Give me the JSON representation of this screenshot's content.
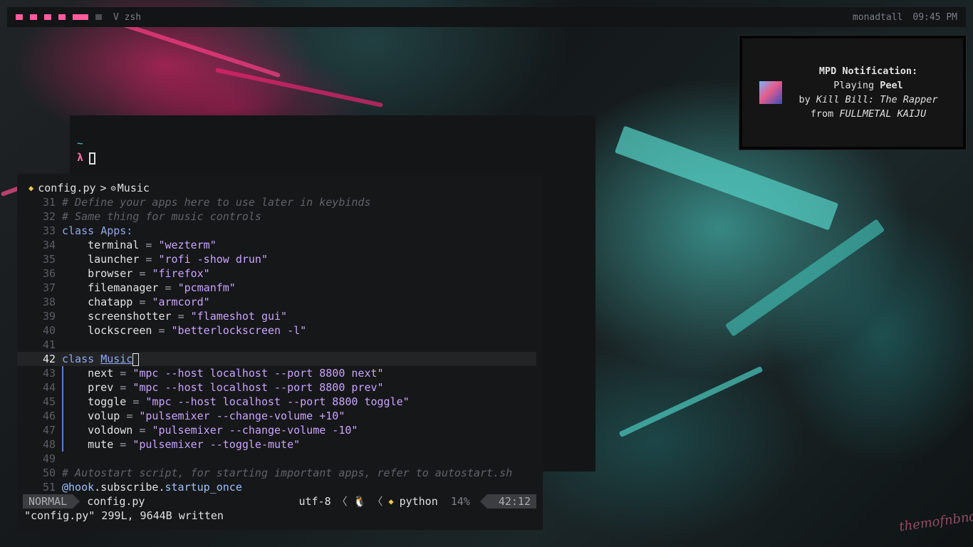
{
  "topbar": {
    "layout_label": "V zsh",
    "hostname": "monadtall",
    "time": "09:45 PM"
  },
  "notification": {
    "title": "MPD Notification:",
    "playing_prefix": "Playing ",
    "track": "Peel",
    "by_prefix": "by ",
    "artist": "Kill Bill: The Rapper",
    "from_prefix": "from ",
    "album": "FULLMETAL KAIJU"
  },
  "terminal": {
    "cwd": "~",
    "prompt": "λ"
  },
  "editor": {
    "breadcrumb": {
      "file": "config.py",
      "sep": ">",
      "symbol": "Music"
    },
    "lines": {
      "l31": {
        "n": "31",
        "comment": "# Define your apps here to use later in keybinds"
      },
      "l32": {
        "n": "32",
        "comment": "# Same thing for music controls"
      },
      "l33": {
        "n": "33",
        "kw": "class",
        "name": "Apps:"
      },
      "l34": {
        "n": "34",
        "var": "terminal",
        "val": "\"wezterm\""
      },
      "l35": {
        "n": "35",
        "var": "launcher",
        "val": "\"rofi -show drun\""
      },
      "l36": {
        "n": "36",
        "var": "browser",
        "val": "\"firefox\""
      },
      "l37": {
        "n": "37",
        "var": "filemanager",
        "val": "\"pcmanfm\""
      },
      "l38": {
        "n": "38",
        "var": "chatapp",
        "val": "\"armcord\""
      },
      "l39": {
        "n": "39",
        "var": "screenshotter",
        "val": "\"flameshot gui\""
      },
      "l40": {
        "n": "40",
        "var": "lockscreen",
        "val": "\"betterlockscreen -l\""
      },
      "l41": {
        "n": "41"
      },
      "l42": {
        "n": "42",
        "kw": "class",
        "name": "Music"
      },
      "l43": {
        "n": "43",
        "var": "next",
        "val": "\"mpc --host localhost --port 8800 next\""
      },
      "l44": {
        "n": "44",
        "var": "prev",
        "val": "\"mpc --host localhost --port 8800 prev\""
      },
      "l45": {
        "n": "45",
        "var": "toggle",
        "val": "\"mpc --host localhost --port 8800 toggle\""
      },
      "l46": {
        "n": "46",
        "var": "volup",
        "val": "\"pulsemixer --change-volume +10\""
      },
      "l47": {
        "n": "47",
        "var": "voldown",
        "val": "\"pulsemixer --change-volume -10\""
      },
      "l48": {
        "n": "48",
        "var": "mute",
        "val": "\"pulsemixer --toggle-mute\""
      },
      "l49": {
        "n": "49"
      },
      "l50": {
        "n": "50",
        "comment": "# Autostart script, for starting important apps, refer to autostart.sh"
      },
      "l51": {
        "n": "51",
        "deco": "@hook",
        "rest1": ".subscribe.",
        "rest2": "startup_once"
      }
    },
    "status": {
      "mode": "NORMAL",
      "file": "config.py",
      "encoding": "utf-8",
      "filetype": "python",
      "percent": "14%",
      "position": "42:12"
    },
    "cmdline": "\"config.py\" 299L, 9644B written"
  },
  "colors": {
    "accent_pink": "#ff5c9d",
    "keyword": "#8fa8f0",
    "string": "#c9a3ff",
    "indent_guide": "#5b7fd1"
  },
  "icons": [
    "python-icon",
    "class-icon",
    "linux-icon",
    "chevron-left-icon"
  ],
  "signature": "themofnbnd"
}
